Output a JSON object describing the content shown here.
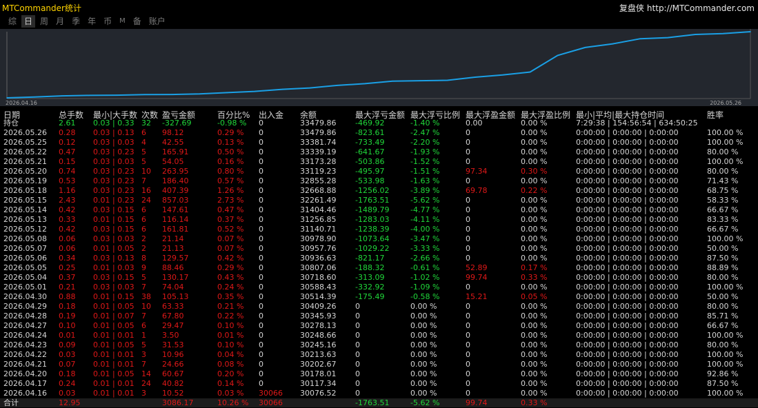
{
  "app": {
    "title": "MTCommander统计",
    "brand_right": "复盘侠",
    "url": "http://MTCommander.com"
  },
  "tabs": [
    {
      "label": "综",
      "active": false
    },
    {
      "label": "日",
      "active": true
    },
    {
      "label": "周",
      "active": false
    },
    {
      "label": "月",
      "active": false
    },
    {
      "label": "季",
      "active": false
    },
    {
      "label": "年",
      "active": false
    },
    {
      "label": "币",
      "active": false
    },
    {
      "label": "M",
      "active": false
    },
    {
      "label": "备",
      "active": false
    },
    {
      "label": "账户",
      "active": false
    }
  ],
  "chart_data": {
    "type": "line",
    "x_start": "2026.04.16",
    "x_end": "2026.05.26",
    "x": [
      "2026.04.16",
      "2026.04.17",
      "2026.04.20",
      "2026.04.21",
      "2026.04.22",
      "2026.04.23",
      "2026.04.24",
      "2026.04.27",
      "2026.04.28",
      "2026.04.29",
      "2026.04.30",
      "2026.05.01",
      "2026.05.04",
      "2026.05.05",
      "2026.05.06",
      "2026.05.07",
      "2026.05.08",
      "2026.05.12",
      "2026.05.13",
      "2026.05.14",
      "2026.05.15",
      "2026.05.18",
      "2026.05.19",
      "2026.05.20",
      "2026.05.21",
      "2026.05.22",
      "2026.05.25",
      "2026.05.26"
    ],
    "values": [
      30076.52,
      30117.34,
      30178.01,
      30202.67,
      30213.63,
      30245.16,
      30248.66,
      30278.13,
      30345.93,
      30409.26,
      30514.39,
      30588.43,
      30718.6,
      30807.06,
      30936.63,
      30957.76,
      30978.9,
      31140.71,
      31256.85,
      31404.46,
      32261.49,
      32668.88,
      32855.28,
      33119.23,
      33173.28,
      33339.19,
      33381.74,
      33479.86
    ],
    "line_color": "#1aa0e6",
    "background": "#23272e"
  },
  "columns": [
    "日期",
    "总手数",
    "最小|大手数",
    "次数",
    "盈亏金额",
    "百分比%",
    "出入金",
    "余额",
    "最大浮亏金额",
    "最大浮亏比例",
    "最大浮盈金额",
    "最大浮盈比例",
    "最小|平均|最大持仓时间",
    "胜率"
  ],
  "holding": {
    "date": "持仓",
    "lots": "2.61",
    "minmax": "0.03 | 0.33",
    "count": "32",
    "pnl": "-327.69",
    "pct": "-0.98 %",
    "flow": "0",
    "balance": "33479.86",
    "maxloss": "-469.92",
    "maxloss_pct": "-1.40 %",
    "maxgain": "0.00",
    "maxgain_pct": "0.00 %",
    "hold": "7:29:38 | 154:56:54 | 634:50:25",
    "win": ""
  },
  "rows": [
    {
      "date": "2026.05.26",
      "lots": "0.28",
      "minmax": "0.03 | 0.13",
      "count": "6",
      "pnl": "98.12",
      "pct": "0.29 %",
      "flow": "0",
      "balance": "33479.86",
      "maxloss": "-823.61",
      "maxloss_pct": "-2.47 %",
      "maxgain": "0",
      "maxgain_pct": "0.00 %",
      "hold": "0:00:00 | 0:00:00 | 0:00:00",
      "win": "100.00 %"
    },
    {
      "date": "2026.05.25",
      "lots": "0.12",
      "minmax": "0.03 | 0.03",
      "count": "4",
      "pnl": "42.55",
      "pct": "0.13 %",
      "flow": "0",
      "balance": "33381.74",
      "maxloss": "-733.49",
      "maxloss_pct": "-2.20 %",
      "maxgain": "0",
      "maxgain_pct": "0.00 %",
      "hold": "0:00:00 | 0:00:00 | 0:00:00",
      "win": "100.00 %"
    },
    {
      "date": "2026.05.22",
      "lots": "0.47",
      "minmax": "0.03 | 0.23",
      "count": "5",
      "pnl": "165.91",
      "pct": "0.50 %",
      "flow": "0",
      "balance": "33339.19",
      "maxloss": "-641.67",
      "maxloss_pct": "-1.93 %",
      "maxgain": "0",
      "maxgain_pct": "0.00 %",
      "hold": "0:00:00 | 0:00:00 | 0:00:00",
      "win": "80.00 %"
    },
    {
      "date": "2026.05.21",
      "lots": "0.15",
      "minmax": "0.03 | 0.03",
      "count": "5",
      "pnl": "54.05",
      "pct": "0.16 %",
      "flow": "0",
      "balance": "33173.28",
      "maxloss": "-503.86",
      "maxloss_pct": "-1.52 %",
      "maxgain": "0",
      "maxgain_pct": "0.00 %",
      "hold": "0:00:00 | 0:00:00 | 0:00:00",
      "win": "100.00 %"
    },
    {
      "date": "2026.05.20",
      "lots": "0.74",
      "minmax": "0.03 | 0.23",
      "count": "10",
      "pnl": "263.95",
      "pct": "0.80 %",
      "flow": "0",
      "balance": "33119.23",
      "maxloss": "-495.97",
      "maxloss_pct": "-1.51 %",
      "maxgain": "97.34",
      "maxgain_pct": "0.30 %",
      "hold": "0:00:00 | 0:00:00 | 0:00:00",
      "win": "80.00 %"
    },
    {
      "date": "2026.05.19",
      "lots": "0.53",
      "minmax": "0.03 | 0.23",
      "count": "7",
      "pnl": "186.40",
      "pct": "0.57 %",
      "flow": "0",
      "balance": "32855.28",
      "maxloss": "-533.98",
      "maxloss_pct": "-1.63 %",
      "maxgain": "0",
      "maxgain_pct": "0.00 %",
      "hold": "0:00:00 | 0:00:00 | 0:00:00",
      "win": "71.43 %"
    },
    {
      "date": "2026.05.18",
      "lots": "1.16",
      "minmax": "0.03 | 0.23",
      "count": "16",
      "pnl": "407.39",
      "pct": "1.26 %",
      "flow": "0",
      "balance": "32668.88",
      "maxloss": "-1256.02",
      "maxloss_pct": "-3.89 %",
      "maxgain": "69.78",
      "maxgain_pct": "0.22 %",
      "hold": "0:00:00 | 0:00:00 | 0:00:00",
      "win": "68.75 %"
    },
    {
      "date": "2026.05.15",
      "lots": "2.43",
      "minmax": "0.01 | 0.23",
      "count": "24",
      "pnl": "857.03",
      "pct": "2.73 %",
      "flow": "0",
      "balance": "32261.49",
      "maxloss": "-1763.51",
      "maxloss_pct": "-5.62 %",
      "maxgain": "0",
      "maxgain_pct": "0.00 %",
      "hold": "0:00:00 | 0:00:00 | 0:00:00",
      "win": "58.33 %"
    },
    {
      "date": "2026.05.14",
      "lots": "0.42",
      "minmax": "0.03 | 0.15",
      "count": "6",
      "pnl": "147.61",
      "pct": "0.47 %",
      "flow": "0",
      "balance": "31404.46",
      "maxloss": "-1489.79",
      "maxloss_pct": "-4.77 %",
      "maxgain": "0",
      "maxgain_pct": "0.00 %",
      "hold": "0:00:00 | 0:00:00 | 0:00:00",
      "win": "66.67 %"
    },
    {
      "date": "2026.05.13",
      "lots": "0.33",
      "minmax": "0.01 | 0.15",
      "count": "6",
      "pnl": "116.14",
      "pct": "0.37 %",
      "flow": "0",
      "balance": "31256.85",
      "maxloss": "-1283.03",
      "maxloss_pct": "-4.11 %",
      "maxgain": "0",
      "maxgain_pct": "0.00 %",
      "hold": "0:00:00 | 0:00:00 | 0:00:00",
      "win": "83.33 %"
    },
    {
      "date": "2026.05.12",
      "lots": "0.42",
      "minmax": "0.03 | 0.15",
      "count": "6",
      "pnl": "161.81",
      "pct": "0.52 %",
      "flow": "0",
      "balance": "31140.71",
      "maxloss": "-1238.39",
      "maxloss_pct": "-4.00 %",
      "maxgain": "0",
      "maxgain_pct": "0.00 %",
      "hold": "0:00:00 | 0:00:00 | 0:00:00",
      "win": "66.67 %"
    },
    {
      "date": "2026.05.08",
      "lots": "0.06",
      "minmax": "0.03 | 0.03",
      "count": "2",
      "pnl": "21.14",
      "pct": "0.07 %",
      "flow": "0",
      "balance": "30978.90",
      "maxloss": "-1073.64",
      "maxloss_pct": "-3.47 %",
      "maxgain": "0",
      "maxgain_pct": "0.00 %",
      "hold": "0:00:00 | 0:00:00 | 0:00:00",
      "win": "100.00 %"
    },
    {
      "date": "2026.05.07",
      "lots": "0.06",
      "minmax": "0.01 | 0.05",
      "count": "2",
      "pnl": "21.13",
      "pct": "0.07 %",
      "flow": "0",
      "balance": "30957.76",
      "maxloss": "-1029.22",
      "maxloss_pct": "-3.33 %",
      "maxgain": "0",
      "maxgain_pct": "0.00 %",
      "hold": "0:00:00 | 0:00:00 | 0:00:00",
      "win": "50.00 %"
    },
    {
      "date": "2026.05.06",
      "lots": "0.34",
      "minmax": "0.03 | 0.13",
      "count": "8",
      "pnl": "129.57",
      "pct": "0.42 %",
      "flow": "0",
      "balance": "30936.63",
      "maxloss": "-821.17",
      "maxloss_pct": "-2.66 %",
      "maxgain": "0",
      "maxgain_pct": "0.00 %",
      "hold": "0:00:00 | 0:00:00 | 0:00:00",
      "win": "87.50 %"
    },
    {
      "date": "2026.05.05",
      "lots": "0.25",
      "minmax": "0.01 | 0.03",
      "count": "9",
      "pnl": "88.46",
      "pct": "0.29 %",
      "flow": "0",
      "balance": "30807.06",
      "maxloss": "-188.32",
      "maxloss_pct": "-0.61 %",
      "maxgain": "52.89",
      "maxgain_pct": "0.17 %",
      "hold": "0:00:00 | 0:00:00 | 0:00:00",
      "win": "88.89 %"
    },
    {
      "date": "2026.05.04",
      "lots": "0.37",
      "minmax": "0.03 | 0.15",
      "count": "5",
      "pnl": "130.17",
      "pct": "0.43 %",
      "flow": "0",
      "balance": "30718.60",
      "maxloss": "-313.09",
      "maxloss_pct": "-1.02 %",
      "maxgain": "99.74",
      "maxgain_pct": "0.33 %",
      "hold": "0:00:00 | 0:00:00 | 0:00:00",
      "win": "80.00 %"
    },
    {
      "date": "2026.05.01",
      "lots": "0.21",
      "minmax": "0.03 | 0.03",
      "count": "7",
      "pnl": "74.04",
      "pct": "0.24 %",
      "flow": "0",
      "balance": "30588.43",
      "maxloss": "-332.92",
      "maxloss_pct": "-1.09 %",
      "maxgain": "0",
      "maxgain_pct": "0.00 %",
      "hold": "0:00:00 | 0:00:00 | 0:00:00",
      "win": "100.00 %"
    },
    {
      "date": "2026.04.30",
      "lots": "0.88",
      "minmax": "0.01 | 0.15",
      "count": "38",
      "pnl": "105.13",
      "pct": "0.35 %",
      "flow": "0",
      "balance": "30514.39",
      "maxloss": "-175.49",
      "maxloss_pct": "-0.58 %",
      "maxgain": "15.21",
      "maxgain_pct": "0.05 %",
      "hold": "0:00:00 | 0:00:00 | 0:00:00",
      "win": "50.00 %"
    },
    {
      "date": "2026.04.29",
      "lots": "0.18",
      "minmax": "0.01 | 0.05",
      "count": "10",
      "pnl": "63.33",
      "pct": "0.21 %",
      "flow": "0",
      "balance": "30409.26",
      "maxloss": "0",
      "maxloss_pct": "0.00 %",
      "maxgain": "0",
      "maxgain_pct": "0.00 %",
      "hold": "0:00:00 | 0:00:00 | 0:00:00",
      "win": "80.00 %"
    },
    {
      "date": "2026.04.28",
      "lots": "0.19",
      "minmax": "0.01 | 0.07",
      "count": "7",
      "pnl": "67.80",
      "pct": "0.22 %",
      "flow": "0",
      "balance": "30345.93",
      "maxloss": "0",
      "maxloss_pct": "0.00 %",
      "maxgain": "0",
      "maxgain_pct": "0.00 %",
      "hold": "0:00:00 | 0:00:00 | 0:00:00",
      "win": "85.71 %"
    },
    {
      "date": "2026.04.27",
      "lots": "0.10",
      "minmax": "0.01 | 0.05",
      "count": "6",
      "pnl": "29.47",
      "pct": "0.10 %",
      "flow": "0",
      "balance": "30278.13",
      "maxloss": "0",
      "maxloss_pct": "0.00 %",
      "maxgain": "0",
      "maxgain_pct": "0.00 %",
      "hold": "0:00:00 | 0:00:00 | 0:00:00",
      "win": "66.67 %"
    },
    {
      "date": "2026.04.24",
      "lots": "0.01",
      "minmax": "0.01 | 0.01",
      "count": "1",
      "pnl": "3.50",
      "pct": "0.01 %",
      "flow": "0",
      "balance": "30248.66",
      "maxloss": "0",
      "maxloss_pct": "0.00 %",
      "maxgain": "0",
      "maxgain_pct": "0.00 %",
      "hold": "0:00:00 | 0:00:00 | 0:00:00",
      "win": "100.00 %"
    },
    {
      "date": "2026.04.23",
      "lots": "0.09",
      "minmax": "0.01 | 0.05",
      "count": "5",
      "pnl": "31.53",
      "pct": "0.10 %",
      "flow": "0",
      "balance": "30245.16",
      "maxloss": "0",
      "maxloss_pct": "0.00 %",
      "maxgain": "0",
      "maxgain_pct": "0.00 %",
      "hold": "0:00:00 | 0:00:00 | 0:00:00",
      "win": "80.00 %"
    },
    {
      "date": "2026.04.22",
      "lots": "0.03",
      "minmax": "0.01 | 0.01",
      "count": "3",
      "pnl": "10.96",
      "pct": "0.04 %",
      "flow": "0",
      "balance": "30213.63",
      "maxloss": "0",
      "maxloss_pct": "0.00 %",
      "maxgain": "0",
      "maxgain_pct": "0.00 %",
      "hold": "0:00:00 | 0:00:00 | 0:00:00",
      "win": "100.00 %"
    },
    {
      "date": "2026.04.21",
      "lots": "0.07",
      "minmax": "0.01 | 0.01",
      "count": "7",
      "pnl": "24.66",
      "pct": "0.08 %",
      "flow": "0",
      "balance": "30202.67",
      "maxloss": "0",
      "maxloss_pct": "0.00 %",
      "maxgain": "0",
      "maxgain_pct": "0.00 %",
      "hold": "0:00:00 | 0:00:00 | 0:00:00",
      "win": "100.00 %"
    },
    {
      "date": "2026.04.20",
      "lots": "0.18",
      "minmax": "0.01 | 0.05",
      "count": "14",
      "pnl": "60.67",
      "pct": "0.20 %",
      "flow": "0",
      "balance": "30178.01",
      "maxloss": "0",
      "maxloss_pct": "0.00 %",
      "maxgain": "0",
      "maxgain_pct": "0.00 %",
      "hold": "0:00:00 | 0:00:00 | 0:00:00",
      "win": "92.86 %"
    },
    {
      "date": "2026.04.17",
      "lots": "0.24",
      "minmax": "0.01 | 0.01",
      "count": "24",
      "pnl": "40.82",
      "pct": "0.14 %",
      "flow": "0",
      "balance": "30117.34",
      "maxloss": "0",
      "maxloss_pct": "0.00 %",
      "maxgain": "0",
      "maxgain_pct": "0.00 %",
      "hold": "0:00:00 | 0:00:00 | 0:00:00",
      "win": "87.50 %"
    },
    {
      "date": "2026.04.16",
      "lots": "0.03",
      "minmax": "0.01 | 0.01",
      "count": "3",
      "pnl": "10.52",
      "pct": "0.03 %",
      "flow": "30066",
      "balance": "30076.52",
      "maxloss": "0",
      "maxloss_pct": "0.00 %",
      "maxgain": "0",
      "maxgain_pct": "0.00 %",
      "hold": "0:00:00 | 0:00:00 | 0:00:00",
      "win": "100.00 %"
    }
  ],
  "totals": {
    "label": "合计",
    "lots": "12.95",
    "pnl": "3086.17",
    "pct": "10.26 %",
    "flow": "30066",
    "maxloss": "-1763.51",
    "maxloss_pct": "-5.62 %",
    "maxgain": "99.74",
    "maxgain_pct": "0.33 %"
  }
}
